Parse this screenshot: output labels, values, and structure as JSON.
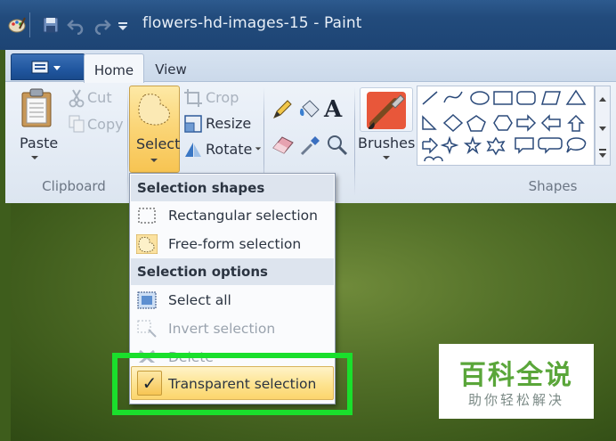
{
  "window": {
    "title": "flowers-hd-images-15 - Paint"
  },
  "tabs": [
    {
      "label": "Home",
      "active": true
    },
    {
      "label": "View",
      "active": false
    }
  ],
  "ribbon": {
    "clipboard": {
      "group_label": "Clipboard",
      "paste_label": "Paste",
      "cut_label": "Cut",
      "copy_label": "Copy"
    },
    "image": {
      "select_label": "Select",
      "crop_label": "Crop",
      "resize_label": "Resize",
      "rotate_label": "Rotate"
    },
    "brushes_label": "Brushes",
    "shapes_label": "Shapes"
  },
  "select_menu": {
    "shapes_header": "Selection shapes",
    "rectangular": "Rectangular selection",
    "freeform": "Free-form selection",
    "options_header": "Selection options",
    "select_all": "Select all",
    "invert": "Invert selection",
    "delete_partial": "Delete",
    "transparent": "Transparent selection",
    "transparent_checked": true
  },
  "watermark": {
    "line1": "百科全说",
    "line2": "助你轻松解决"
  },
  "colors": {
    "highlight": "#1adf2c",
    "select_button": "#fbd679",
    "titlebar": "#224b7c"
  }
}
